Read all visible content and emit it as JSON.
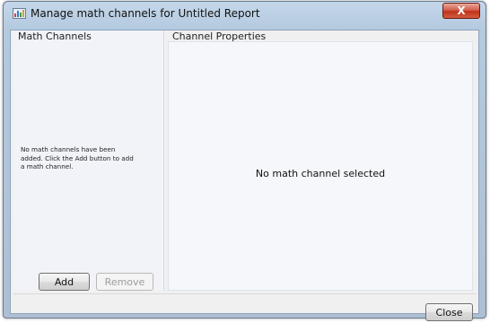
{
  "window": {
    "title": "Manage math channels for Untitled Report",
    "close_glyph": "X"
  },
  "left_panel": {
    "heading": "Math Channels",
    "empty_message": "No math channels have been added. Click the Add button to add a math channel.",
    "add_label": "Add",
    "remove_label": "Remove"
  },
  "right_panel": {
    "heading": "Channel Properties",
    "empty_message": "No math channel selected"
  },
  "footer": {
    "close_label": "Close"
  },
  "colors": {
    "title_gradient": "#c5d7ea",
    "close_button": "#c0321c"
  }
}
